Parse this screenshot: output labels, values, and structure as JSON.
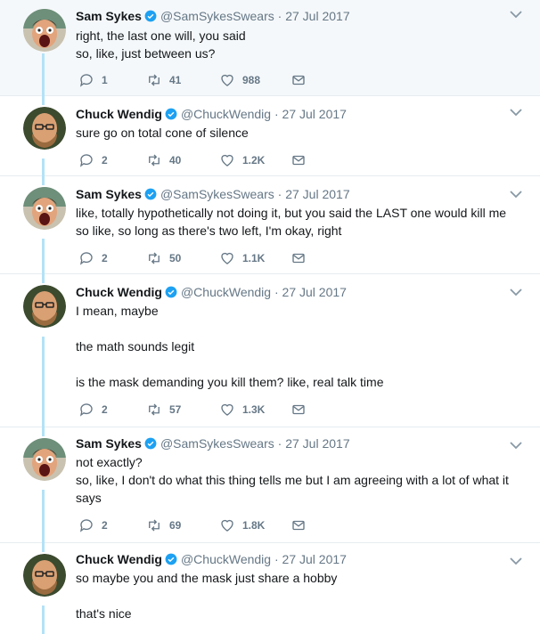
{
  "tweets": [
    {
      "name": "Sam Sykes",
      "handle": "@SamSykesSwears",
      "date": "27 Jul 2017",
      "lines": [
        "right, the last one will, you said",
        "so, like, just between us?"
      ],
      "replies": "1",
      "retweets": "41",
      "likes": "988"
    },
    {
      "name": "Chuck Wendig",
      "handle": "@ChuckWendig",
      "date": "27 Jul 2017",
      "lines": [
        "sure go on total cone of silence"
      ],
      "replies": "2",
      "retweets": "40",
      "likes": "1.2K"
    },
    {
      "name": "Sam Sykes",
      "handle": "@SamSykesSwears",
      "date": "27 Jul 2017",
      "lines": [
        "like, totally hypothetically not doing it, but you said the LAST one would kill me",
        "so like, so long as there's two left, I'm okay, right"
      ],
      "replies": "2",
      "retweets": "50",
      "likes": "1.1K"
    },
    {
      "name": "Chuck Wendig",
      "handle": "@ChuckWendig",
      "date": "27 Jul 2017",
      "lines": [
        "I mean, maybe",
        "",
        "the math sounds legit",
        "",
        "is the mask demanding you kill them? like, real talk time"
      ],
      "replies": "2",
      "retweets": "57",
      "likes": "1.3K"
    },
    {
      "name": "Sam Sykes",
      "handle": "@SamSykesSwears",
      "date": "27 Jul 2017",
      "lines": [
        "not exactly?",
        "so, like, I don't do what this thing tells me but I am agreeing with a lot of what it",
        "says"
      ],
      "replies": "2",
      "retweets": "69",
      "likes": "1.8K"
    },
    {
      "name": "Chuck Wendig",
      "handle": "@ChuckWendig",
      "date": "27 Jul 2017",
      "lines": [
        "so maybe you and the mask just share a hobby",
        "",
        "that's nice"
      ]
    }
  ],
  "separator": "·",
  "colors": {
    "thread": "#b3e2f7",
    "verified": "#1da1f2",
    "meta": "#657786",
    "highlight_bg": "#f5f8fa"
  }
}
